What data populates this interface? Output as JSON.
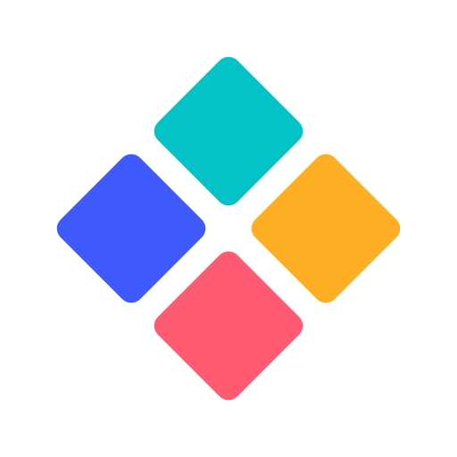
{
  "logo": {
    "icon": "four-diamond-tiles-logo",
    "tiles": [
      {
        "position": "top",
        "color": "#04C3C6"
      },
      {
        "position": "left",
        "color": "#3F5AFC"
      },
      {
        "position": "right",
        "color": "#FDAE22"
      },
      {
        "position": "bottom",
        "color": "#FF5A72"
      }
    ]
  }
}
